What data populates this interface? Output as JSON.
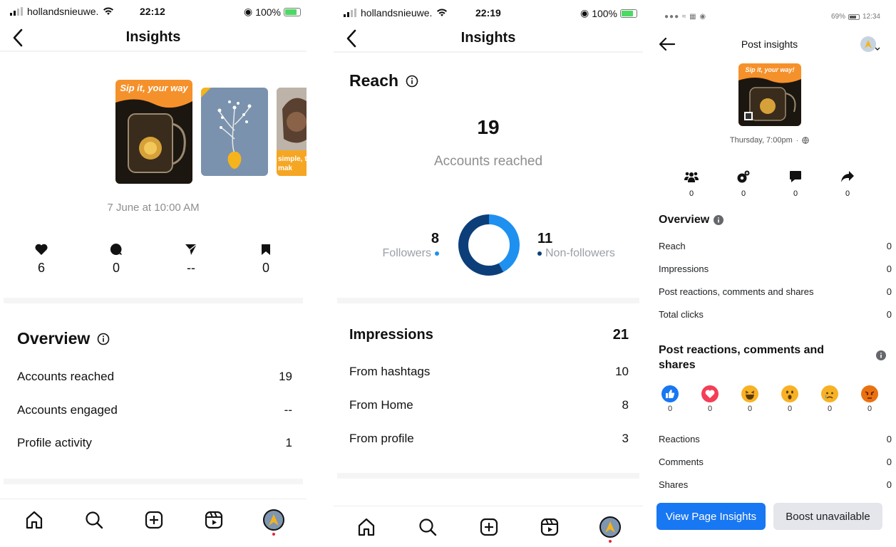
{
  "instagram_post": {
    "status": {
      "carrier": "hollandsnieuwe.",
      "time": "22:12",
      "battery": "100%"
    },
    "title": "Insights",
    "thumbnail_caption": "Sip it, your way",
    "thumbnail_3_caption": "simple, t it mak",
    "date": "7 June at 10:00 AM",
    "stats": [
      {
        "icon": "heart-icon",
        "value": "6"
      },
      {
        "icon": "comment-icon",
        "value": "0"
      },
      {
        "icon": "share-icon",
        "value": "--"
      },
      {
        "icon": "bookmark-icon",
        "value": "0"
      }
    ],
    "overview": {
      "title": "Overview",
      "rows": [
        {
          "label": "Accounts reached",
          "value": "19"
        },
        {
          "label": "Accounts engaged",
          "value": "--"
        },
        {
          "label": "Profile activity",
          "value": "1"
        }
      ]
    }
  },
  "instagram_reach": {
    "status": {
      "carrier": "hollandsnieuwe.",
      "time": "22:19",
      "battery": "100%"
    },
    "title": "Insights",
    "reach": {
      "title": "Reach",
      "accounts_reached": "19",
      "accounts_reached_label": "Accounts reached",
      "followers": "8",
      "followers_label": "Followers",
      "non_followers": "11",
      "non_followers_label": "Non-followers",
      "followers_color": "#1e90f0",
      "non_followers_color": "#0c3f7a"
    },
    "impressions": {
      "label": "Impressions",
      "value": "21",
      "rows": [
        {
          "label": "From hashtags",
          "value": "10"
        },
        {
          "label": "From Home",
          "value": "8"
        },
        {
          "label": "From profile",
          "value": "3"
        }
      ]
    }
  },
  "facebook": {
    "status": {
      "time": "12:34",
      "battery": "69%"
    },
    "title": "Post insights",
    "thumbnail_caption": "Sip it, your way!",
    "date": "Thursday, 7:00pm",
    "stats": [
      {
        "icon": "people-reached-icon",
        "value": "0"
      },
      {
        "icon": "engagement-icon",
        "value": "0"
      },
      {
        "icon": "comment-bubble-icon",
        "value": "0"
      },
      {
        "icon": "share-arrow-icon",
        "value": "0"
      }
    ],
    "overview": {
      "title": "Overview",
      "rows": [
        {
          "label": "Reach",
          "value": "0"
        },
        {
          "label": "Impressions",
          "value": "0"
        },
        {
          "label": "Post reactions, comments and shares",
          "value": "0"
        },
        {
          "label": "Total clicks",
          "value": "0"
        }
      ]
    },
    "reactions_section": {
      "title": "Post reactions, comments and shares",
      "reactions": [
        {
          "name": "like-icon",
          "value": "0",
          "color": "#1877f2"
        },
        {
          "name": "love-icon",
          "value": "0",
          "color": "#f33e58"
        },
        {
          "name": "haha-icon",
          "value": "0",
          "color": "#f7b125"
        },
        {
          "name": "wow-icon",
          "value": "0",
          "color": "#f7b125"
        },
        {
          "name": "sad-icon",
          "value": "0",
          "color": "#f7b125"
        },
        {
          "name": "angry-icon",
          "value": "0",
          "color": "#e9710f"
        }
      ],
      "rows": [
        {
          "label": "Reactions",
          "value": "0"
        },
        {
          "label": "Comments",
          "value": "0"
        },
        {
          "label": "Shares",
          "value": "0"
        }
      ]
    },
    "buttons": {
      "primary": "View Page Insights",
      "secondary": "Boost unavailable"
    },
    "colors": {
      "primary": "#1877f2"
    }
  }
}
